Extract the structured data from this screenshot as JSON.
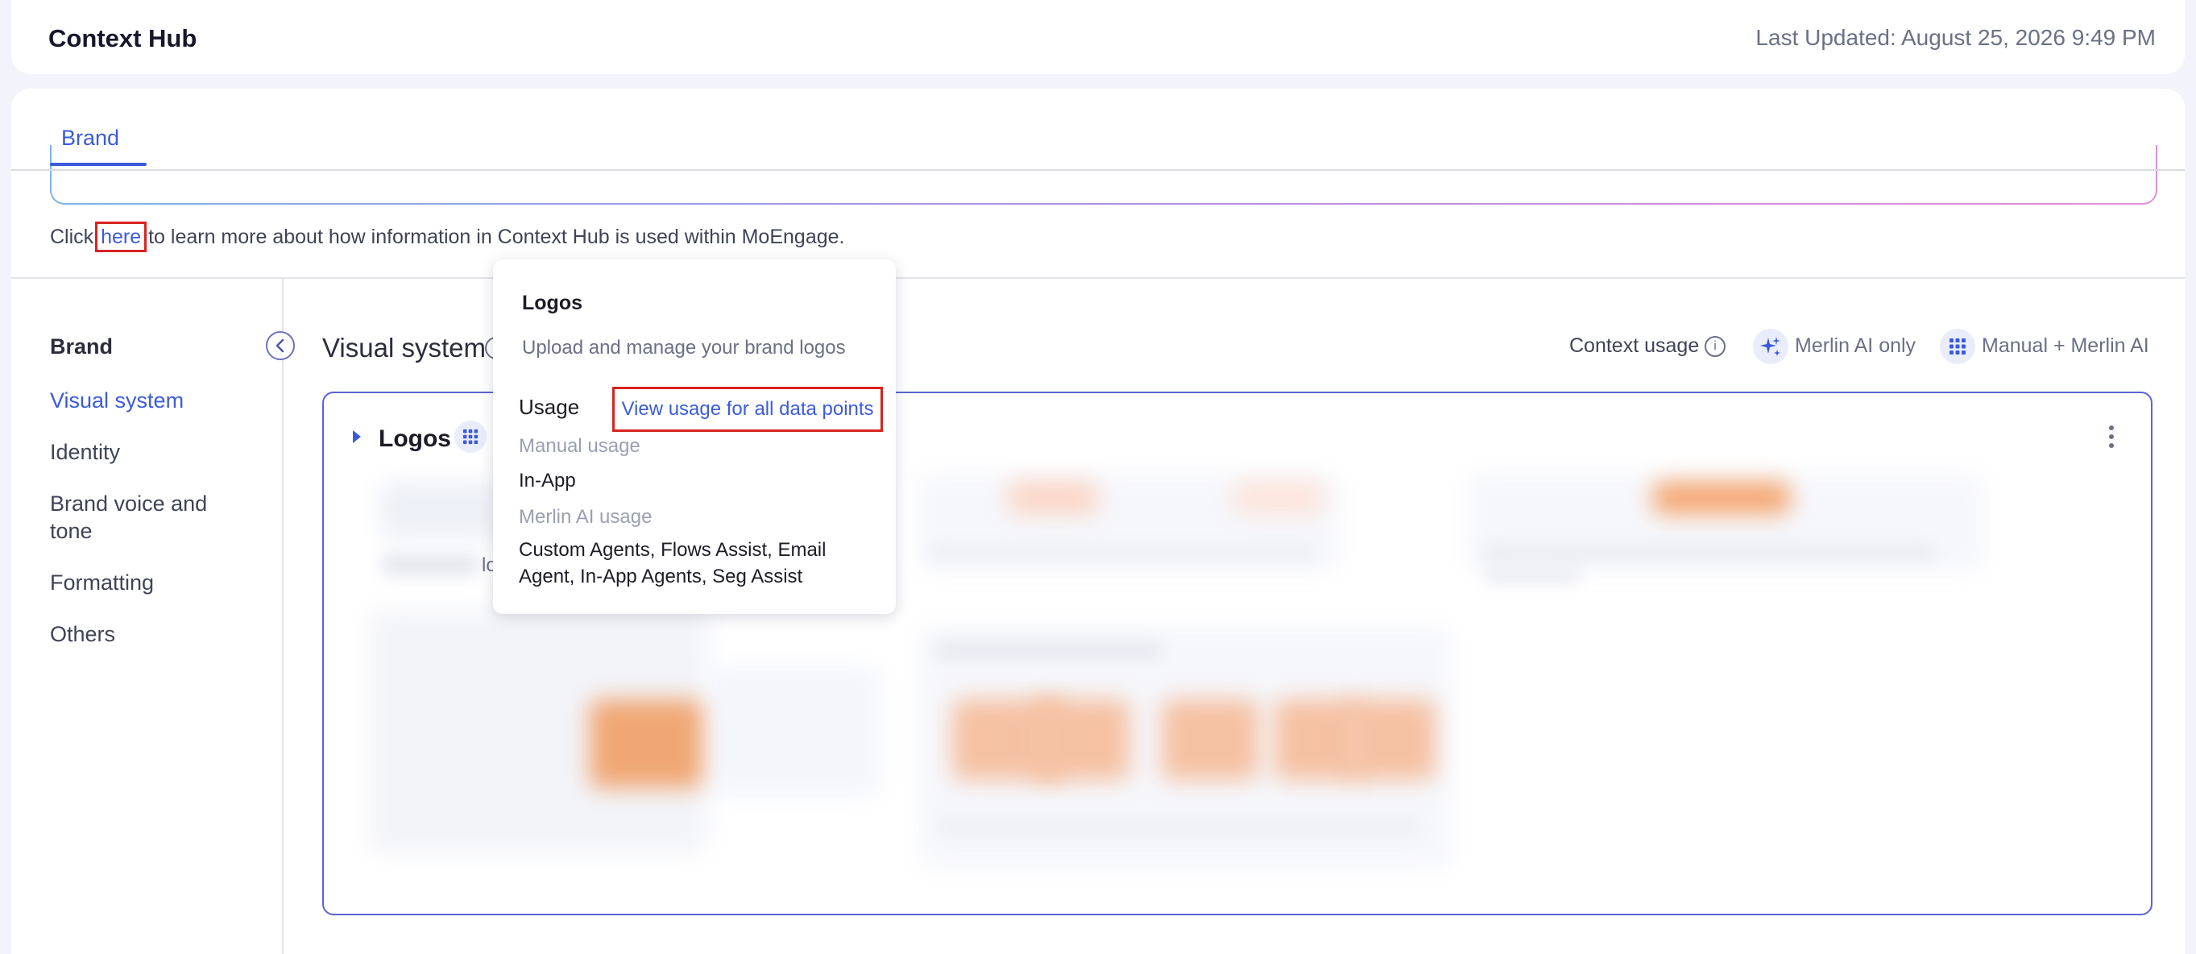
{
  "header": {
    "title": "Context Hub",
    "last_updated": "Last Updated: August 25, 2026 9:49 PM"
  },
  "tabs": [
    {
      "label": "Brand",
      "active": true
    }
  ],
  "info_line": {
    "prefix": "Click ",
    "link": "here",
    "suffix": " to learn more about how information in Context Hub is used within MoEngage."
  },
  "sidebar": {
    "title": "Brand",
    "items": [
      {
        "label": "Visual system",
        "active": true
      },
      {
        "label": "Identity",
        "active": false
      },
      {
        "label": "Brand voice and tone",
        "active": false
      },
      {
        "label": "Formatting",
        "active": false
      },
      {
        "label": "Others",
        "active": false
      }
    ]
  },
  "content": {
    "title": "Visual system",
    "context_usage_label": "Context usage",
    "legend": [
      {
        "icon": "sparkle-icon",
        "label": "Merlin AI only"
      },
      {
        "icon": "grid-icon",
        "label": "Manual + Merlin AI"
      }
    ]
  },
  "logos_panel": {
    "title": "Logos",
    "partial_text": "lo"
  },
  "popover": {
    "title": "Logos",
    "description": "Upload and manage your brand logos",
    "usage_label": "Usage",
    "usage_link": "View usage for all data points",
    "manual_usage_label": "Manual usage",
    "manual_usage_value": "In-App",
    "merlin_usage_label": "Merlin AI usage",
    "merlin_usage_value": "Custom Agents, Flows Assist, Email Agent, In-App Agents, Seg Assist"
  },
  "colors": {
    "accent": "#3b5bdb",
    "highlight_box": "#d8231f",
    "panel_border": "#5b63d6",
    "background": "#f3f4fb"
  }
}
